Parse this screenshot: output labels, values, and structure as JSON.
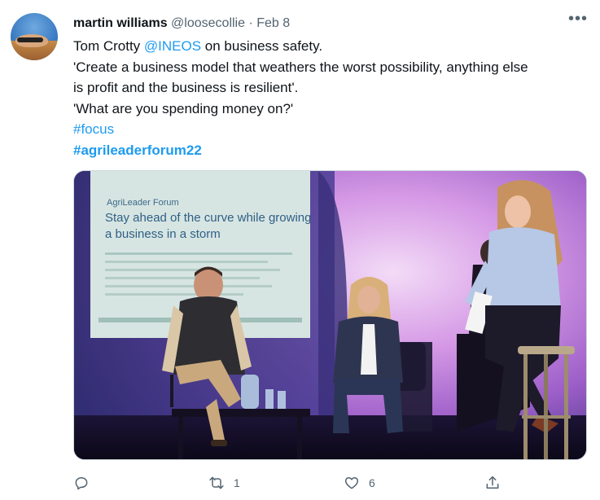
{
  "tweet": {
    "author_name": "martin williams",
    "handle": "@loosecollie",
    "separator": "·",
    "date": "Feb 8",
    "more_label": "•••",
    "text_lines": {
      "l1_prefix": "Tom Crotty ",
      "l1_mention": "@INEOS",
      "l1_suffix": " on business safety.",
      "l2": "'Create a business model that weathers the worst possibility, anything else",
      "l3": "is profit and the business is resilient'.",
      "l4": "'What are you spending money on?'",
      "hashtag1": "#focus",
      "hashtag2": "#agrileaderforum22"
    },
    "photo": {
      "slide_org": "AgriLeader Forum",
      "slide_line1": "Stay ahead of the curve while growing",
      "slide_line2": "a business in a storm"
    },
    "actions": {
      "reply_count": "",
      "retweet_count": "1",
      "like_count": "6"
    },
    "colors": {
      "link": "#1d9bf0",
      "text": "#0f1419",
      "muted": "#536471"
    }
  }
}
